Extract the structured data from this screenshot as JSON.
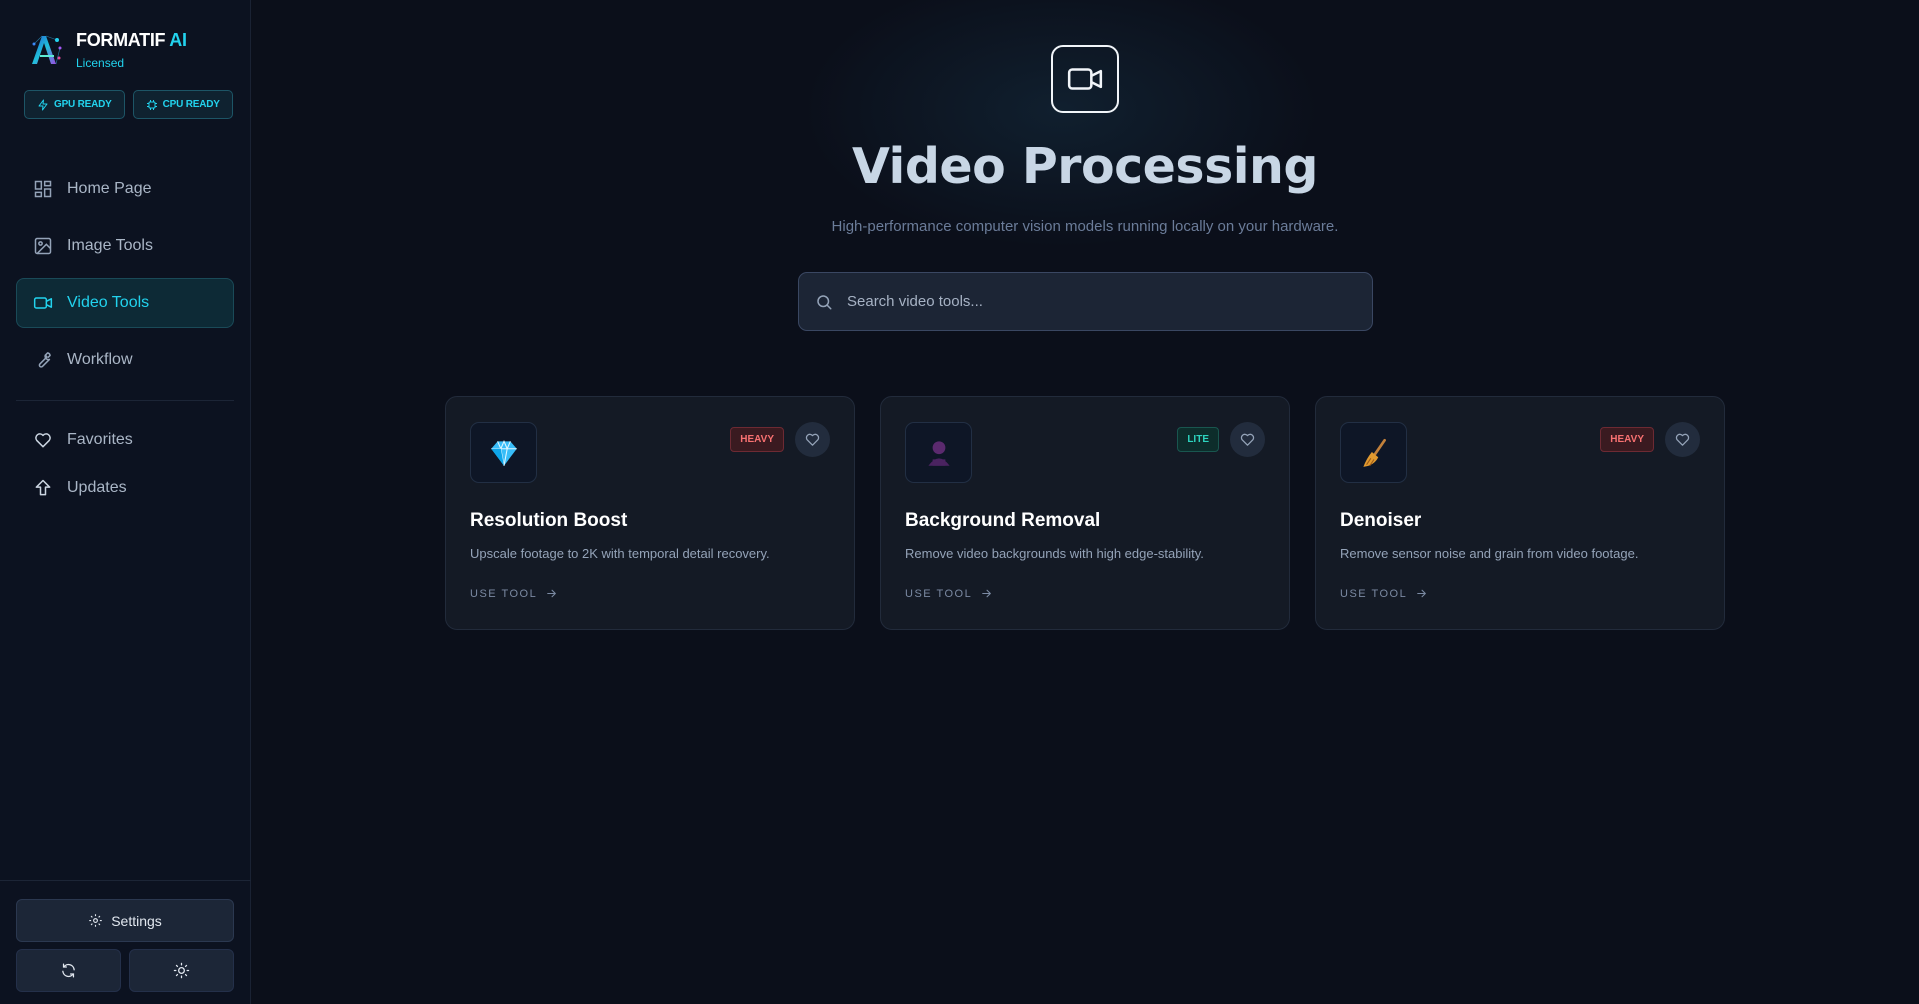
{
  "brand": {
    "name": "FORMATIF",
    "name_accent": "AI",
    "subtitle": "Licensed"
  },
  "status_badges": [
    {
      "label": "GPU READY",
      "icon": "lightning-icon"
    },
    {
      "label": "CPU READY",
      "icon": "chip-icon"
    }
  ],
  "nav": {
    "items": [
      {
        "label": "Home Page",
        "icon": "grid-icon",
        "active": false
      },
      {
        "label": "Image Tools",
        "icon": "image-icon",
        "active": false
      },
      {
        "label": "Video Tools",
        "icon": "video-icon",
        "active": true
      },
      {
        "label": "Workflow",
        "icon": "wrench-icon",
        "active": false
      }
    ],
    "secondary": [
      {
        "label": "Favorites",
        "icon": "heart-icon"
      },
      {
        "label": "Updates",
        "icon": "upload-arrow-icon"
      }
    ]
  },
  "footer": {
    "settings_label": "Settings",
    "refresh_icon": "refresh-icon",
    "theme_icon": "sun-icon"
  },
  "page": {
    "icon": "video-camera-icon",
    "title": "Video Processing",
    "subtitle": "High-performance computer vision models running locally on your hardware.",
    "search_placeholder": "Search video tools..."
  },
  "tools": [
    {
      "title": "Resolution Boost",
      "description": "Upscale footage to 2K with temporal detail recovery.",
      "tag": "HEAVY",
      "icon": "diamond-icon",
      "link": "USE TOOL"
    },
    {
      "title": "Background Removal",
      "description": "Remove video backgrounds with high edge-stability.",
      "tag": "LITE",
      "icon": "person-silhouette-icon",
      "link": "USE TOOL"
    },
    {
      "title": "Denoiser",
      "description": "Remove sensor noise and grain from video footage.",
      "tag": "HEAVY",
      "icon": "broom-icon",
      "link": "USE TOOL"
    }
  ],
  "colors": {
    "accent": "#22d3ee",
    "heavy": "#f87171",
    "lite": "#2dd4bf",
    "background": "#0b0f1a"
  }
}
